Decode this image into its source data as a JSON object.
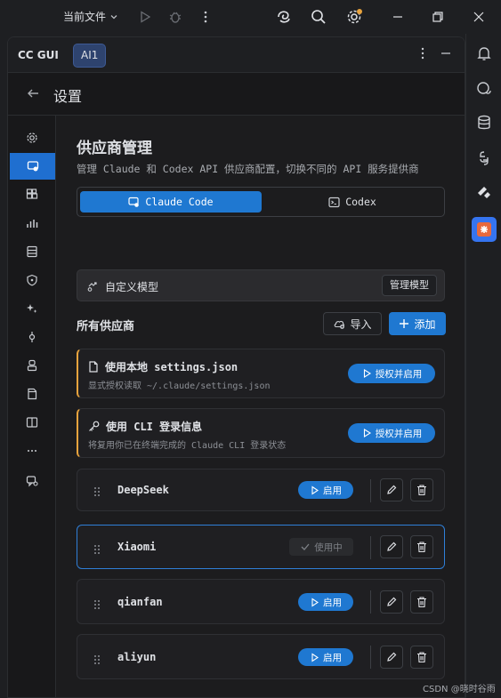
{
  "titlebar": {
    "file_label": "当前文件"
  },
  "toolwindow": {
    "title": "CC GUI",
    "tab_label": "AI1"
  },
  "settings": {
    "title": "设置"
  },
  "page": {
    "title": "供应商管理",
    "subtitle": "管理 Claude 和 Codex API 供应商配置，切换不同的 API 服务提供商",
    "tabs": [
      {
        "label": "Claude Code",
        "active": true
      },
      {
        "label": "Codex",
        "active": false
      }
    ],
    "custom_model": {
      "label": "自定义模型",
      "button": "管理模型"
    },
    "section_title": "所有供应商",
    "import_label": "导入",
    "add_label": "添加",
    "special_cards": [
      {
        "title": "使用本地 settings.json",
        "desc": "显式授权读取 ~/.claude/settings.json",
        "button": "授权并启用",
        "icon": "file-icon"
      },
      {
        "title": "使用 CLI 登录信息",
        "desc": "将复用你已在终端完成的 Claude CLI 登录状态",
        "button": "授权并启用",
        "icon": "key-icon"
      }
    ],
    "providers": [
      {
        "name": "DeepSeek",
        "status": "启用",
        "in_use": false
      },
      {
        "name": "Xiaomi",
        "status": "使用中",
        "in_use": true
      },
      {
        "name": "qianfan",
        "status": "启用",
        "in_use": false
      },
      {
        "name": "aliyun",
        "status": "启用",
        "in_use": false
      }
    ]
  },
  "watermark": "CSDN @晓时谷雨",
  "colors": {
    "accent": "#1f78d1",
    "warn": "#e8a33d",
    "background": "#1c1c1e"
  }
}
